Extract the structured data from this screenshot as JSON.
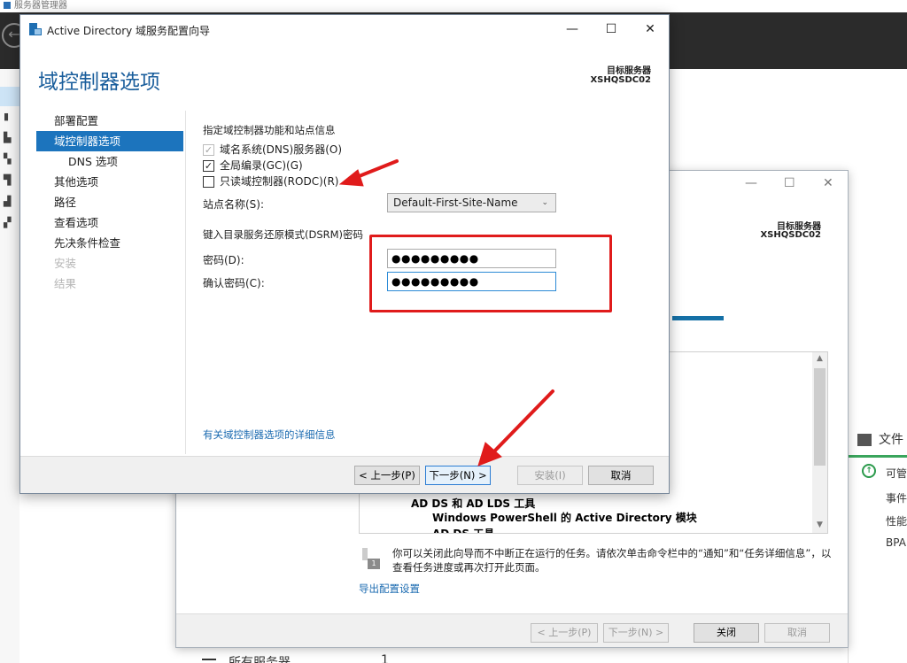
{
  "server_manager": {
    "title": "服务器管理器",
    "bottom_item_label": "所有服务器",
    "bottom_item_count": "1",
    "right_panel": {
      "title": "文件",
      "items": [
        "可管",
        "事件",
        "性能",
        "BPA"
      ]
    }
  },
  "wizard_bg": {
    "target_label": "目标服务器",
    "target_name": "XSHQSDC02",
    "progress_percent": 100,
    "result_lines": [
      "AD DS 和 AD LDS 工具",
      "Windows PowerShell 的 Active Directory 模块",
      "AD DS 工具"
    ],
    "note_icon_number": "1",
    "note": "你可以关闭此向导而不中断正在运行的任务。请依次单击命令栏中的“通知”和“任务详细信息”，以查看任务进度或再次打开此页面。",
    "export_link": "导出配置设置",
    "buttons": {
      "prev": "< 上一步(P)",
      "next": "下一步(N) >",
      "close": "关闭",
      "cancel": "取消"
    }
  },
  "wizard": {
    "title": "Active Directory 域服务配置向导",
    "page_title": "域控制器选项",
    "target_label": "目标服务器",
    "target_name": "XSHQSDC02",
    "nav": [
      {
        "label": "部署配置",
        "state": "normal"
      },
      {
        "label": "域控制器选项",
        "state": "active"
      },
      {
        "label": "DNS 选项",
        "state": "sub"
      },
      {
        "label": "其他选项",
        "state": "normal"
      },
      {
        "label": "路径",
        "state": "normal"
      },
      {
        "label": "查看选项",
        "state": "normal"
      },
      {
        "label": "先决条件检查",
        "state": "normal"
      },
      {
        "label": "安装",
        "state": "disabled"
      },
      {
        "label": "结果",
        "state": "disabled"
      }
    ],
    "section_functions": "指定域控制器功能和站点信息",
    "checkboxes": {
      "dns": {
        "label": "域名系统(DNS)服务器(O)",
        "checked": true,
        "enabled": false
      },
      "gc": {
        "label": "全局编录(GC)(G)",
        "checked": true,
        "enabled": true
      },
      "rodc": {
        "label": "只读域控制器(RODC)(R)",
        "checked": false,
        "enabled": true
      }
    },
    "site_label": "站点名称(S):",
    "site_value": "Default-First-Site-Name",
    "section_dsrm": "键入目录服务还原模式(DSRM)密码",
    "password_label": "密码(D):",
    "password_value": "●●●●●●●●●",
    "confirm_label": "确认密码(C):",
    "confirm_value": "●●●●●●●●●",
    "more_link": "有关域控制器选项的详细信息",
    "buttons": {
      "prev": "< 上一步(P)",
      "next": "下一步(N) >",
      "install": "安装(I)",
      "cancel": "取消"
    }
  },
  "colors": {
    "accent": "#1c74bd",
    "annotation": "#e01b1b",
    "header_dark": "#2b2b2b"
  }
}
